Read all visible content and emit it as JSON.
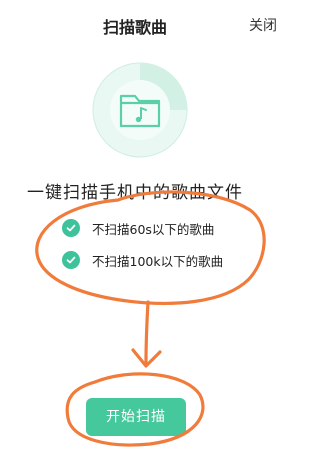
{
  "header": {
    "title": "扫描歌曲",
    "close_label": "关闭"
  },
  "main": {
    "heading": "一键扫描手机中的歌曲文件",
    "options": [
      {
        "label": "不扫描60s以下的歌曲",
        "checked": true
      },
      {
        "label": "不扫描100k以下的歌曲",
        "checked": true
      }
    ],
    "start_button_label": "开始扫描"
  },
  "colors": {
    "accent": "#45c99c",
    "check": "#3ec29b",
    "annotation": "#f07b3a"
  },
  "icons": {
    "illustration": "music-folder-icon",
    "check": "check-icon"
  }
}
